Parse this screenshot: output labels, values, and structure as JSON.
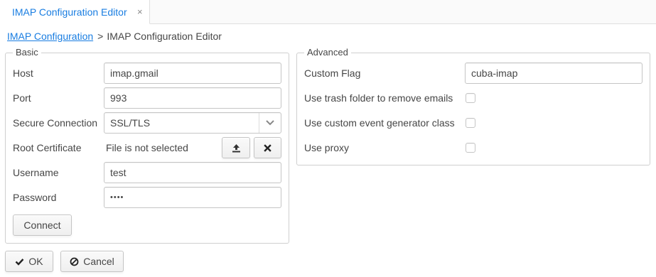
{
  "tab": {
    "title": "IMAP Configuration Editor",
    "close": "×"
  },
  "breadcrumb": {
    "link": "IMAP Configuration",
    "separator": ">",
    "current": "IMAP Configuration Editor"
  },
  "basic": {
    "legend": "Basic",
    "host": {
      "label": "Host",
      "value": "imap.gmail"
    },
    "port": {
      "label": "Port",
      "value": "993"
    },
    "secure_connection": {
      "label": "Secure Connection",
      "value": "SSL/TLS"
    },
    "root_certificate": {
      "label": "Root Certificate",
      "value": "File is not selected"
    },
    "username": {
      "label": "Username",
      "value": "test"
    },
    "password": {
      "label": "Password",
      "value": "••••"
    },
    "connect_button": "Connect"
  },
  "advanced": {
    "legend": "Advanced",
    "custom_flag": {
      "label": "Custom Flag",
      "value": "cuba-imap"
    },
    "use_trash_folder": {
      "label": "Use trash folder to remove emails",
      "checked": false
    },
    "use_custom_event_generator": {
      "label": "Use custom event generator class",
      "checked": false
    },
    "use_proxy": {
      "label": "Use proxy",
      "checked": false
    }
  },
  "footer": {
    "ok_button": "OK",
    "cancel_button": "Cancel"
  },
  "colors": {
    "accent": "#197de1",
    "text": "#464646",
    "border": "#c5c5c5"
  }
}
